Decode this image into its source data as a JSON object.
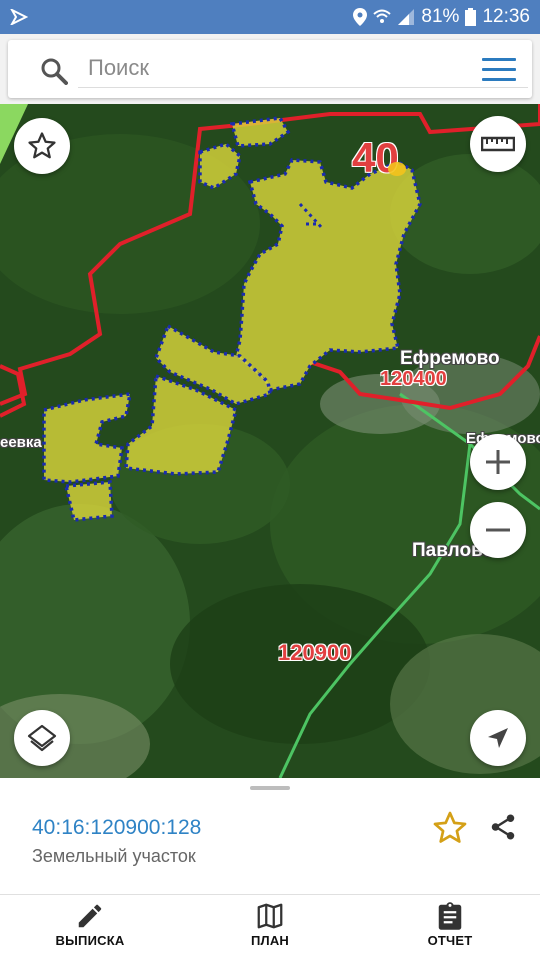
{
  "status_bar": {
    "battery": "81%",
    "time": "12:36"
  },
  "search": {
    "placeholder": "Поиск"
  },
  "map": {
    "labels": {
      "region_number": "40",
      "village_efremovo": "Ефремово",
      "quarter_120400": "120400",
      "village_efremovo_partial": "Ефремово",
      "village_pavlovo": "Павлово",
      "quarter_120900": "120900",
      "village_left_partial": "еевка"
    },
    "colors": {
      "boundary": "#e0202a",
      "parcel_fill": "#d8d43a",
      "parcel_dots": "#1a2bb0",
      "road": "#4dc463"
    }
  },
  "parcel": {
    "cadastral_number": "40:16:120900:128",
    "type": "Земельный участок"
  },
  "bottom_nav": {
    "items": [
      {
        "label": "ВЫПИСКА",
        "icon": "pencil-icon"
      },
      {
        "label": "ПЛАН",
        "icon": "map-icon"
      },
      {
        "label": "ОТЧЕТ",
        "icon": "clipboard-icon"
      }
    ]
  }
}
